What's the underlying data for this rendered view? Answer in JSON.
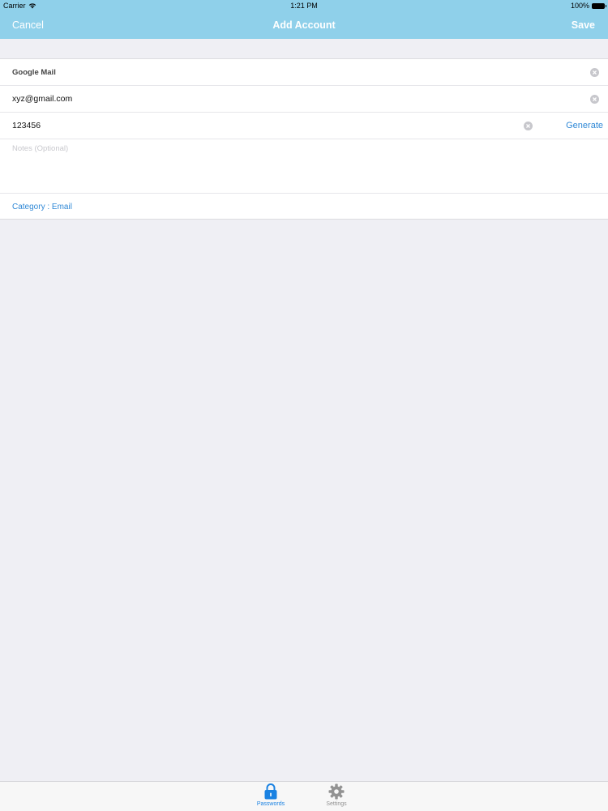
{
  "status_bar": {
    "carrier": "Carrier",
    "time": "1:21 PM",
    "battery": "100%"
  },
  "nav": {
    "cancel_label": "Cancel",
    "title": "Add Account",
    "save_label": "Save"
  },
  "form": {
    "title_value": "Google Mail",
    "email_value": "xyz@gmail.com",
    "password_value": "123456",
    "generate_label": "Generate",
    "notes_placeholder": "Notes (Optional)",
    "notes_value": "",
    "category_label": "Category : Email"
  },
  "tabs": [
    {
      "label": "Passwords",
      "icon": "lock-icon",
      "selected": true
    },
    {
      "label": "Settings",
      "icon": "gear-icon",
      "selected": false
    }
  ],
  "colors": {
    "nav_background": "#8fd0ea",
    "accent": "#2f88d6",
    "tab_selected": "#1a82e2",
    "tab_unselected": "#929292",
    "background": "#efeff4"
  }
}
